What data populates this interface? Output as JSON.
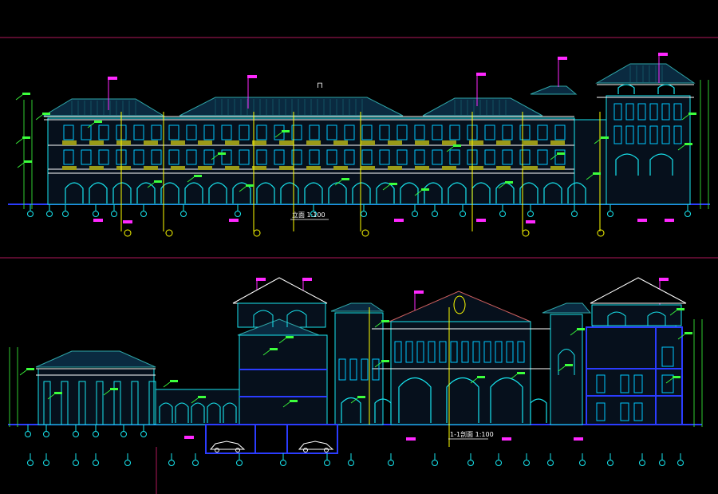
{
  "drawing": {
    "background": "#000000",
    "palette": {
      "frame": "#b0185a",
      "outline": "#18e6f0",
      "window": "#00c8ff",
      "roof": "#2fa6a8",
      "roof_fill": "#0a2a40",
      "floor_line": "#ffffff",
      "annotation": "#3cff3c",
      "tag": "#ff28ff",
      "axis": "#ffff00",
      "section_blue": "#2b3cff",
      "band": "#9a9a18"
    },
    "top_elevation": {
      "title": "立面 1:100",
      "axis_bubbles": 8
    },
    "bottom_elevation": {
      "title": "1-1剖面 1:100",
      "axis_bubbles": 24
    },
    "cursor_mark": "⊓"
  }
}
